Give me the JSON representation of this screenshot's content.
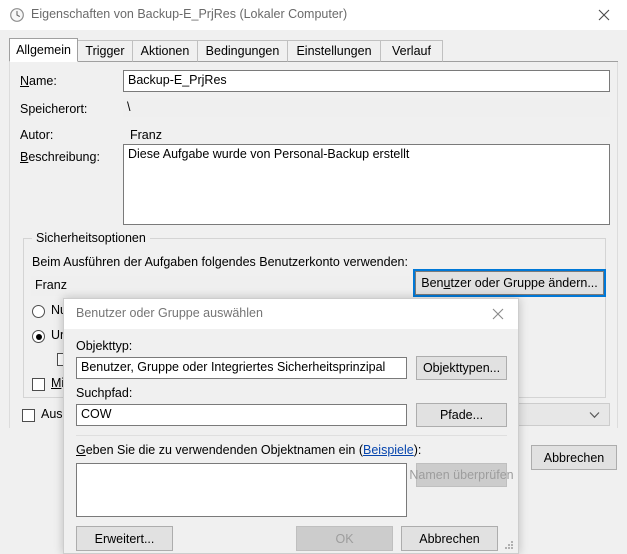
{
  "window": {
    "title": "Eigenschaften von Backup-E_PrjRes (Lokaler Computer)",
    "icon": "clock-icon",
    "close_label": "×",
    "accent_color": "#0078d7"
  },
  "tabs": [
    {
      "label": "Allgemein",
      "active": true
    },
    {
      "label": "Trigger",
      "active": false
    },
    {
      "label": "Aktionen",
      "active": false
    },
    {
      "label": "Bedingungen",
      "active": false
    },
    {
      "label": "Einstellungen",
      "active": false
    },
    {
      "label": "Verlauf",
      "active": false
    }
  ],
  "general": {
    "name_label": "Name:",
    "name_label_accel": "N",
    "name_value": "Backup-E_PrjRes",
    "location_label": "Speicherort:",
    "location_value": "\\",
    "author_label": "Autor:",
    "author_value": "Franz",
    "description_label": "Beschreibung:",
    "description_label_accel": "B",
    "description_value": "Diese Aufgabe wurde von Personal-Backup erstellt"
  },
  "security": {
    "group_title": "Sicherheitsoptionen",
    "account_prompt": "Beim Ausführen der Aufgaben folgendes Benutzerkonto verwenden:",
    "account_value": "Franz",
    "change_user_button": "Benutzer oder Gruppe ändern...",
    "change_user_accel": "u",
    "radio_only_label": "Nu",
    "radio_only_selected": false,
    "radio_independent_label": "Un",
    "radio_independent_selected": true,
    "sub_checkbox_label": "",
    "sub_checkbox_checked": false,
    "hidden_checkbox_label": "Mit",
    "hidden_checkbox_checked": false
  },
  "footer": {
    "config_checkbox_label": "Ausg",
    "config_checkbox_checked": false,
    "config_combo_value": "",
    "config_combo_chevron": "chevron-down-icon",
    "cancel_button": "Abbrechen"
  },
  "modal": {
    "title": "Benutzer oder Gruppe auswählen",
    "close_label": "×",
    "object_type_label": "Objekttyp:",
    "object_type_value": "Benutzer, Gruppe oder Integriertes Sicherheitsprinzipal",
    "object_types_button": "Objekttypen...",
    "search_path_label": "Suchpfad:",
    "search_path_value": "COW",
    "object_names_label_pre": "Geben Sie die zu verwendenden Objektnamen ein (",
    "object_names_label_accel": "G",
    "object_names_link": "Beispiele",
    "object_names_label_post": "):",
    "object_names_value": "",
    "check_names_button": "Namen überprüfen",
    "check_names_disabled": true,
    "advanced_button": "Erweitert...",
    "ok_button": "OK",
    "ok_disabled": true,
    "cancel_button": "Abbrechen",
    "resize_grip": "resize-grip-icon"
  }
}
